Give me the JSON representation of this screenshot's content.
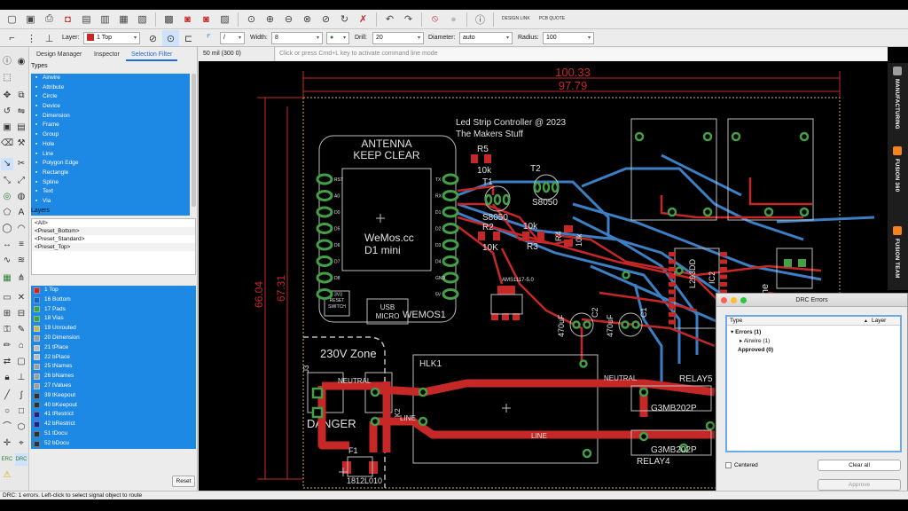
{
  "toolbar": {
    "design_link": "DESIGN LINK",
    "pcb_quote": "PCB QUOTE"
  },
  "params": {
    "layer_label": "Layer:",
    "layer_value": "1 Top",
    "width_label": "Width:",
    "width_value": "8",
    "drill_label": "Drill:",
    "drill_value": "20",
    "diameter_label": "Diameter:",
    "diameter_value": "auto",
    "radius_label": "Radius:",
    "radius_value": "100"
  },
  "left_panel": {
    "tabs": [
      "Design Manager",
      "Inspector",
      "Selection Filter"
    ],
    "types_label": "Types",
    "types": [
      "Airwire",
      "Attribute",
      "Circle",
      "Device",
      "Dimension",
      "Frame",
      "Group",
      "Hole",
      "Line",
      "Polygon Edge",
      "Rectangle",
      "Spline",
      "Text",
      "Via"
    ],
    "layers_label": "Layers",
    "presets": [
      "<All>",
      "<Preset_Bottom>",
      "<Preset_Standard>",
      "<Preset_Top>"
    ],
    "layers": [
      {
        "name": "1 Top",
        "color": "#c62828"
      },
      {
        "name": "16 Bottom",
        "color": "#1565c0"
      },
      {
        "name": "17 Pads",
        "color": "#43a047"
      },
      {
        "name": "18 Vias",
        "color": "#43a047"
      },
      {
        "name": "19 Unrouted",
        "color": "#c9b458"
      },
      {
        "name": "20 Dimension",
        "color": "#9e9e9e"
      },
      {
        "name": "21 tPlace",
        "color": "#bdbdbd"
      },
      {
        "name": "22 bPlace",
        "color": "#bdbdbd"
      },
      {
        "name": "25 tNames",
        "color": "#9e9e9e"
      },
      {
        "name": "26 bNames",
        "color": "#9e9e9e"
      },
      {
        "name": "27 tValues",
        "color": "#9e9e9e"
      },
      {
        "name": "39 tKeepout",
        "color": "#263238"
      },
      {
        "name": "40 bKeepout",
        "color": "#263238"
      },
      {
        "name": "41 tRestrict",
        "color": "#1a237e"
      },
      {
        "name": "42 bRestrict",
        "color": "#1a237e"
      },
      {
        "name": "51 tDocu",
        "color": "#263238"
      },
      {
        "name": "52 bDocu",
        "color": "#263238"
      }
    ],
    "reset_label": "Reset"
  },
  "canvas": {
    "coord": "50 mil (300 0)",
    "command_placeholder": "Click or press Cmd+L key to activate command line mode"
  },
  "board": {
    "dim_100_33": "100.33",
    "dim_97_79": "97.79",
    "dim_66_04": "66.04",
    "dim_67_31": "67.31",
    "title_line1": "Led Strip Controller @ 2023",
    "title_line2": "The Makers Stuff",
    "antenna_1": "ANTENNA",
    "antenna_2": "KEEP CLEAR",
    "wemos_1": "WeMos.cc",
    "wemos_2": "D1 mini",
    "wemos_name": "WEMOS1",
    "usb_1": "USB",
    "usb_2": "MICRO",
    "reset_1": "RESET",
    "reset_2": "SWITCH",
    "r5": "R5",
    "r5_val": "10k",
    "t1": "T1",
    "t2": "T2",
    "t1_val": "S8050",
    "t2_val": "S8050",
    "r2": "R2",
    "r2_val": "10K",
    "r3": "R3",
    "r3_val": "10k",
    "r4": "R4",
    "r4_val": "10k",
    "ams": "AMS1117-5.0",
    "c_470a": "470uF",
    "c_470b": "470uF",
    "c2": "C2",
    "c1": "C1",
    "ic2": "IC2",
    "l293": "L293DD",
    "zone_230": "230V Zone",
    "danger": "DANGER",
    "hlk": "HLK1",
    "neutral_1": "NEUTRAL",
    "neutral_2": "NEUTRAL",
    "line_1": "LINE",
    "line_2": "LINE",
    "relay_a": "G3MB202P",
    "relay_b": "G3MB202P",
    "relay4": "RELAY4",
    "relay5": "RELAY5",
    "f1": "F1",
    "fuse": "1812L010",
    "j3": "J3",
    "tk": "TK2",
    "zone_r": "Zone",
    "pin_labels_l": [
      "RST",
      "A0",
      "D0",
      "D5",
      "D6",
      "D7",
      "D8",
      "3V3"
    ],
    "pin_labels_r": [
      "TX",
      "RX",
      "D1",
      "D2",
      "D3",
      "D4",
      "GND",
      "5V"
    ]
  },
  "right_tabs": [
    "MANUFACTURING",
    "FUSION 360",
    "FUSION TEAM"
  ],
  "status_text": "DRC: 1 errors. Left-click to select signal object to route",
  "drc": {
    "title": "DRC Errors",
    "col_type": "Type",
    "col_layer": "Layer",
    "errors": "Errors (1)",
    "airwire": "Airwire (1)",
    "approved": "Approved (0)",
    "centered": "Centered",
    "clear_all": "Clear all",
    "approve": "Approve"
  }
}
